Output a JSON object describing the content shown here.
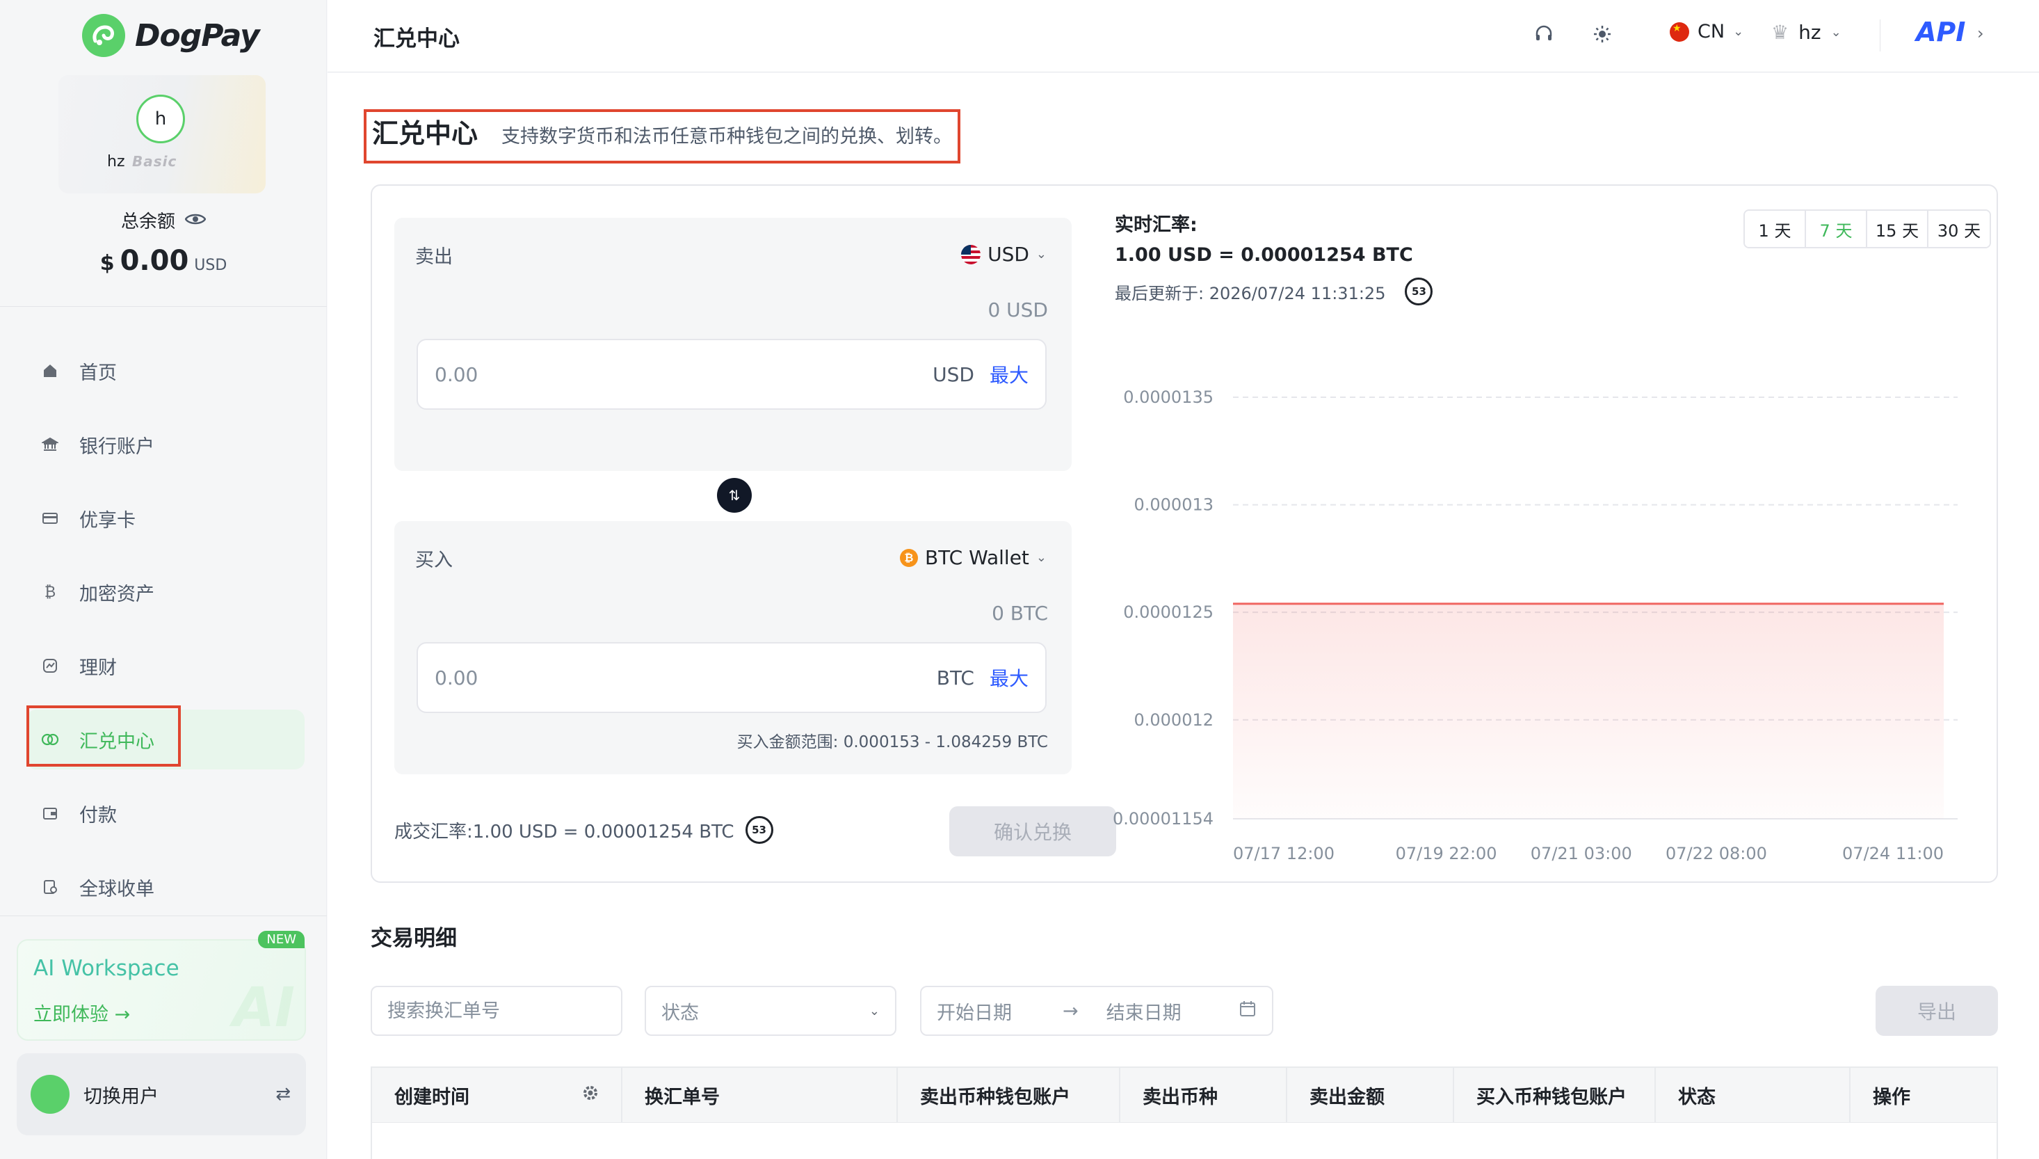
{
  "app": {
    "name": "DogPay"
  },
  "profile": {
    "initial": "h",
    "name": "hz",
    "level": "Basic",
    "balance_label": "总余额",
    "balance_currency_symbol": "$",
    "balance_value": "0.00",
    "balance_unit": "USD"
  },
  "sidebar": {
    "items": [
      {
        "label": "首页",
        "icon": "home-icon"
      },
      {
        "label": "银行账户",
        "icon": "bank-icon"
      },
      {
        "label": "优享卡",
        "icon": "card-icon"
      },
      {
        "label": "加密资产",
        "icon": "bitcoin-icon"
      },
      {
        "label": "理财",
        "icon": "finance-icon"
      },
      {
        "label": "汇兑中心",
        "icon": "exchange-icon",
        "active": true
      },
      {
        "label": "付款",
        "icon": "wallet-icon"
      },
      {
        "label": "全球收单",
        "icon": "acquiring-icon"
      }
    ],
    "ai_card": {
      "title": "AI Workspace",
      "link": "立即体验 →",
      "badge": "NEW",
      "bg_text": "AI"
    },
    "switch_user": {
      "label": "切换用户"
    }
  },
  "topbar": {
    "title": "汇兑中心",
    "lang": "CN",
    "user": "hz",
    "api": "API"
  },
  "page": {
    "title": "汇兑中心",
    "subtitle": "支持数字货币和法币任意币种钱包之间的兑换、划转。"
  },
  "exchange": {
    "sell": {
      "label": "卖出",
      "currency": "USD",
      "balance": "0 USD",
      "placeholder": "0.00",
      "unit": "USD",
      "max": "最大"
    },
    "buy": {
      "label": "买入",
      "currency": "BTC Wallet",
      "balance": "0 BTC",
      "placeholder": "0.00",
      "unit": "BTC",
      "max": "最大",
      "range": "买入金额范围:  0.000153 - 1.084259 BTC"
    },
    "deal_rate": "成交汇率:1.00 USD = 0.00001254 BTC",
    "countdown": "53",
    "confirm": "确认兑换",
    "rate_label": "实时汇率:",
    "rate_value": "1.00 USD = 0.00001254 BTC",
    "updated": "最后更新于: 2026/07/24 11:31:25",
    "range_tabs": [
      {
        "label": "1 天"
      },
      {
        "label": "7 天",
        "active": true
      },
      {
        "label": "15 天"
      },
      {
        "label": "30 天"
      }
    ]
  },
  "chart_data": {
    "type": "area",
    "x": [
      "07/17 12:00",
      "07/24 11:00"
    ],
    "x_ticks": [
      "07/17 12:00",
      "07/19 22:00",
      "07/21 03:00",
      "07/22 08:00",
      "07/24 11:00"
    ],
    "y_ticks": [
      "0.0000135",
      "0.000013",
      "0.0000125",
      "0.000012",
      "0.00001154"
    ],
    "series": [
      {
        "values": [
          1.254e-05,
          1.254e-05
        ]
      }
    ],
    "ylim": [
      1.154e-05,
      1.35e-05
    ],
    "grid": true,
    "colors": {
      "line": "#f06560",
      "fill": "#fdecea"
    }
  },
  "transactions": {
    "title": "交易明细",
    "search_placeholder": "搜索换汇单号",
    "status_placeholder": "状态",
    "start_placeholder": "开始日期",
    "end_placeholder": "结束日期",
    "export": "导出",
    "columns": [
      "创建时间",
      "换汇单号",
      "卖出币种钱包账户",
      "卖出币种",
      "卖出金额",
      "买入币种钱包账户",
      "状态",
      "操作"
    ]
  }
}
